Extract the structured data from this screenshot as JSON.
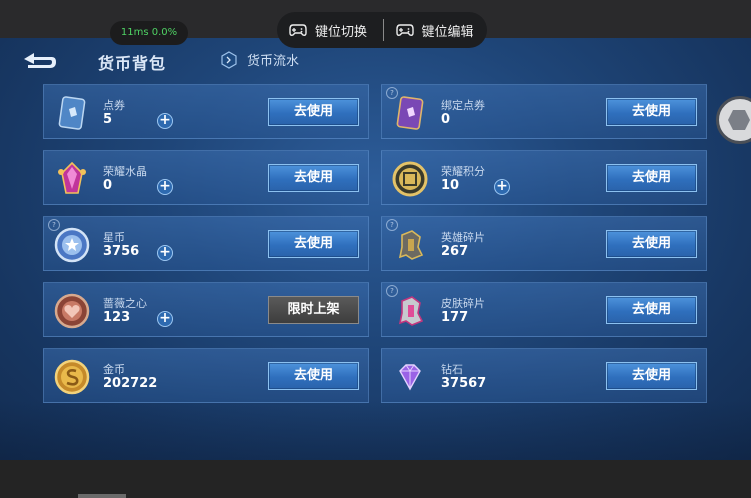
{
  "overlay": {
    "stats": "11ms  0.0%",
    "key_switch_label": "键位切换",
    "key_edit_label": "键位编辑"
  },
  "header": {
    "title": "货币背包",
    "flow_label": "货币流水"
  },
  "cards": [
    {
      "name": "点券",
      "amount": "5",
      "button": "去使用",
      "icon": "ticket-card-icon"
    },
    {
      "name": "绑定点券",
      "amount": "0",
      "button": "去使用",
      "icon": "bound-ticket-icon"
    },
    {
      "name": "荣耀水晶",
      "amount": "0",
      "button": "去使用",
      "icon": "glory-crystal-icon"
    },
    {
      "name": "荣耀积分",
      "amount": "10",
      "button": "去使用",
      "icon": "glory-points-icon"
    },
    {
      "name": "星币",
      "amount": "3756",
      "button": "去使用",
      "icon": "star-coin-icon"
    },
    {
      "name": "英雄碎片",
      "amount": "267",
      "button": "去使用",
      "icon": "hero-fragment-icon"
    },
    {
      "name": "蔷薇之心",
      "amount": "123",
      "button": "限时上架",
      "icon": "rose-heart-icon"
    },
    {
      "name": "皮肤碎片",
      "amount": "177",
      "button": "去使用",
      "icon": "skin-fragment-icon"
    },
    {
      "name": "金币",
      "amount": "202722",
      "button": "去使用",
      "icon": "gold-coin-icon"
    },
    {
      "name": "钻石",
      "amount": "37567",
      "button": "去使用",
      "icon": "diamond-icon"
    }
  ],
  "colors": {
    "background": "#1f4679",
    "button": "#2f6fbd",
    "limited_button": "#3d3d3d",
    "latency": "#4fd264"
  }
}
